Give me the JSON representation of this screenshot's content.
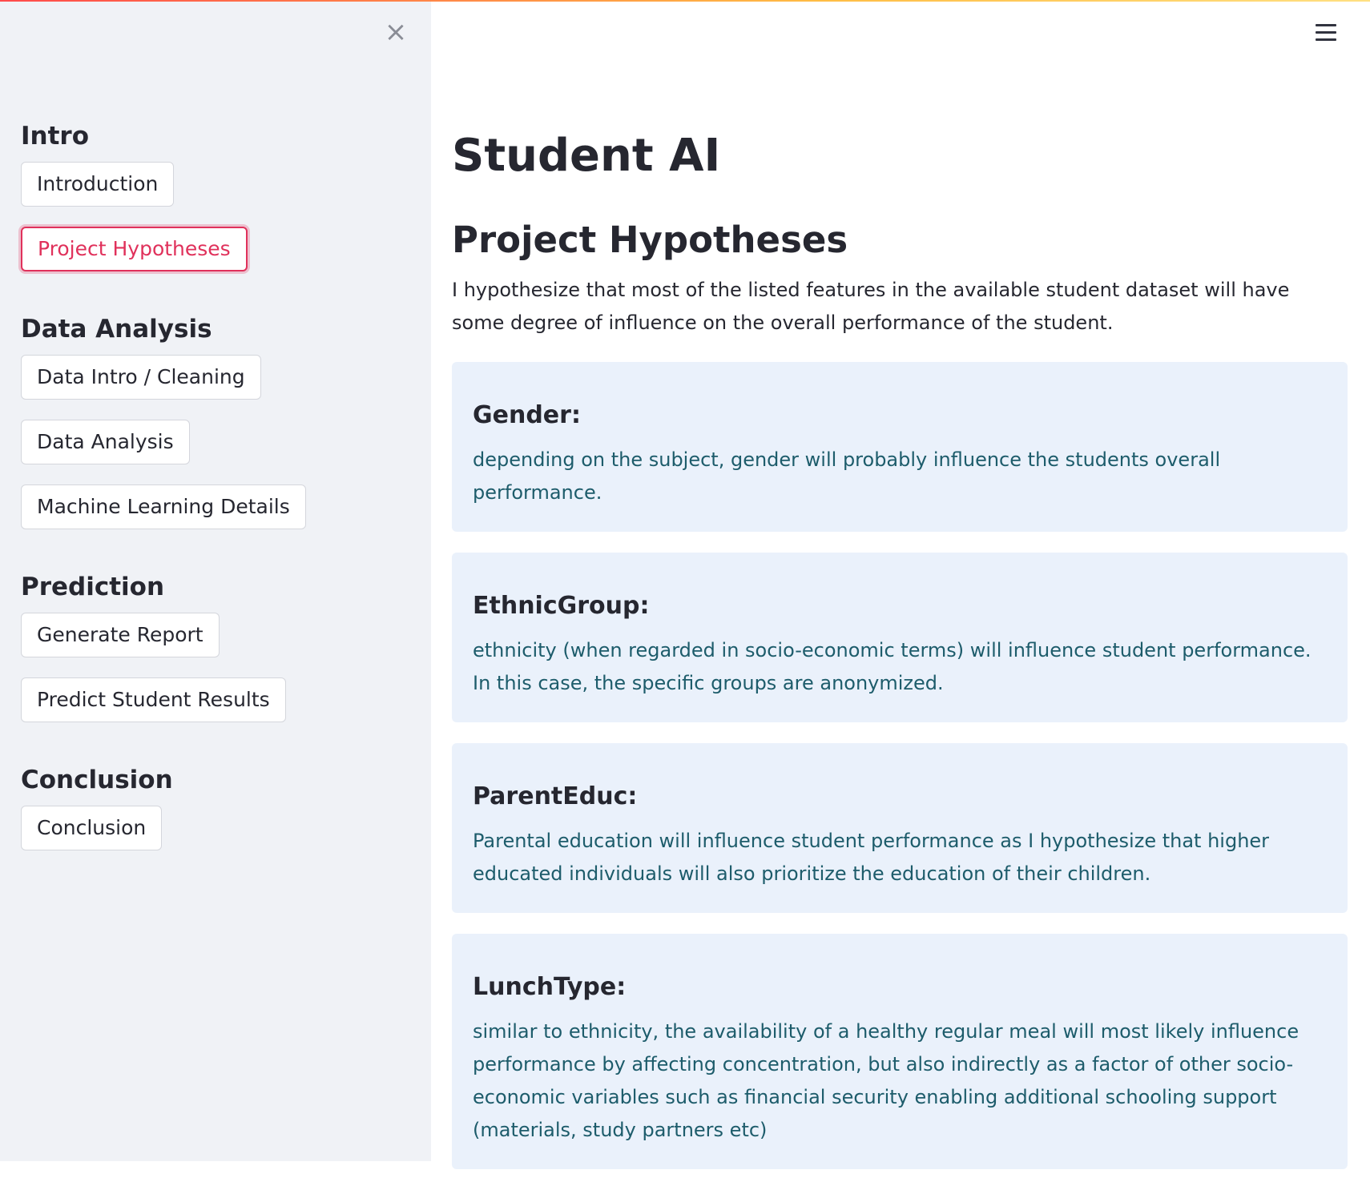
{
  "sidebar": {
    "close_icon": "×",
    "sections": [
      {
        "title": "Intro",
        "buttons": [
          "Introduction",
          "Project Hypotheses"
        ]
      },
      {
        "title": "Data Analysis",
        "buttons": [
          "Data Intro / Cleaning",
          "Data Analysis",
          "Machine Learning Details"
        ]
      },
      {
        "title": "Prediction",
        "buttons": [
          "Generate Report",
          "Predict Student Results"
        ]
      },
      {
        "title": "Conclusion",
        "buttons": [
          "Conclusion"
        ]
      }
    ],
    "active_button": "Project Hypotheses"
  },
  "header": {
    "menu_icon": "hamburger-menu-icon"
  },
  "main": {
    "title": "Student AI",
    "subtitle": "Project Hypotheses",
    "intro": "I hypothesize that most of the listed features in the available student dataset will have some degree of influence on the overall performance of the student.",
    "cards": [
      {
        "title": "Gender:",
        "text": "depending on the subject, gender will probably influence the students overall performance."
      },
      {
        "title": "EthnicGroup:",
        "text": "ethnicity (when regarded in socio-economic terms) will influence student performance. In this case, the specific groups are anonymized."
      },
      {
        "title": "ParentEduc:",
        "text": "Parental education will influence student performance as I hypothesize that higher educated individuals will also prioritize the education of their children."
      },
      {
        "title": "LunchType:",
        "text": "similar to ethnicity, the availability of a healthy regular meal will most likely influence performance by affecting concentration, but also indirectly as a factor of other socio-economic variables such as financial security enabling additional schooling support (materials, study partners etc)"
      }
    ]
  },
  "colors": {
    "accent": "#e0315b",
    "sidebar_bg": "#f0f2f6",
    "card_bg": "#eaf1fb",
    "card_text": "#1d5c6b"
  }
}
